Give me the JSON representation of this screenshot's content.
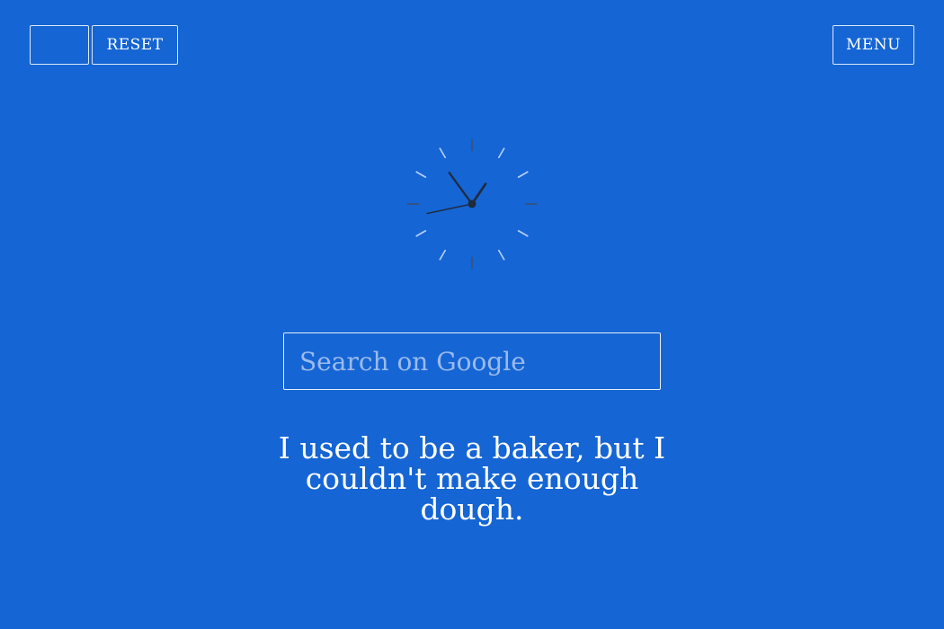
{
  "toolbar": {
    "blank_label": "",
    "reset_label": "RESET",
    "menu_label": "MENU"
  },
  "clock": {
    "hour_hand_angle_deg": 34,
    "minute_hand_angle_deg": -36,
    "second_hand_angle_deg": -102,
    "face_tick_color": "#b8d2ff",
    "hand_color": "#1f2a3c"
  },
  "search": {
    "placeholder": "Search on Google",
    "value": ""
  },
  "quote": {
    "text": "I used to be a baker, but I couldn't make enough dough."
  },
  "theme": {
    "background": "#1565d4",
    "foreground": "#ffffff"
  }
}
